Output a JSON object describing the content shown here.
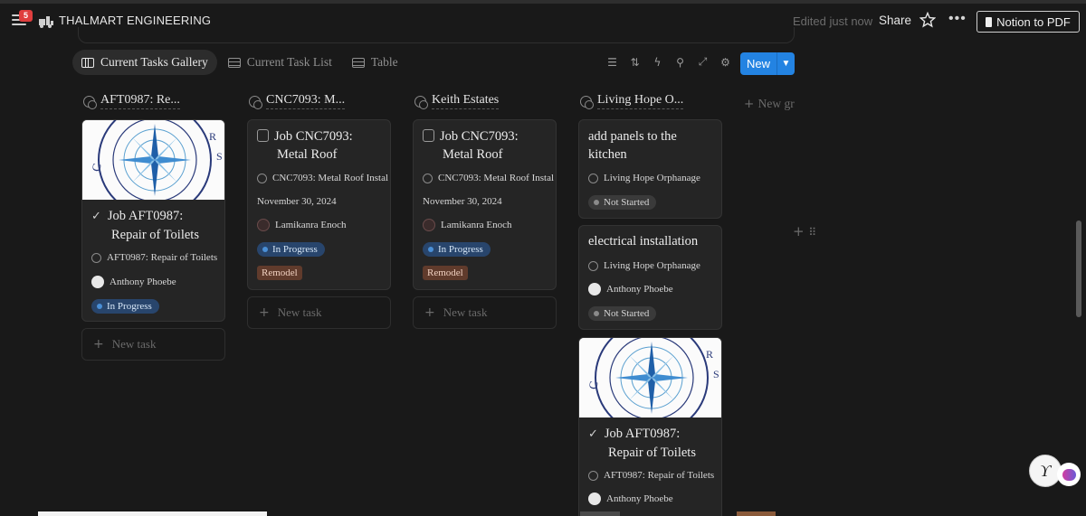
{
  "topbar": {
    "notification_count": "5",
    "workspace_title": "THALMART ENGINEERING",
    "edited_status": "Edited just now",
    "share_label": "Share",
    "notion_pdf_label": "Notion to PDF"
  },
  "views": {
    "tabs": [
      {
        "label": "Current Tasks Gallery",
        "active": true,
        "icon": "gallery-icon"
      },
      {
        "label": "Current Task List",
        "active": false,
        "icon": "table-icon"
      },
      {
        "label": "Table",
        "active": false,
        "icon": "table-icon"
      }
    ],
    "new_label": "New"
  },
  "toolbar_icons": [
    "filter-icon",
    "sort-icon",
    "automation-icon",
    "search-icon",
    "expand-icon",
    "settings-icon"
  ],
  "groups": [
    {
      "title": "AFT0987: Re..."
    },
    {
      "title": "CNC7093: M..."
    },
    {
      "title": "Keith Estates"
    },
    {
      "title": "Living Hope O..."
    }
  ],
  "new_group_label": "New gr",
  "new_task_label": "New task",
  "cards": {
    "aft_1": {
      "title_line1": "Job AFT0987:",
      "title_line2": "Repair of Toilets",
      "project": "AFT0987: Repair of Toilets",
      "assignee": "Anthony Phoebe",
      "status": "In Progress"
    },
    "cnc_1": {
      "title_line1": "Job CNC7093:",
      "title_line2": "Metal Roof",
      "project": "CNC7093: Metal Roof Instal",
      "date": "November 30, 2024",
      "assignee": "Lamikanra Enoch",
      "status": "In Progress",
      "tag": "Remodel"
    },
    "keith_1": {
      "title_line1": "Job CNC7093:",
      "title_line2": "Metal Roof",
      "project": "CNC7093: Metal Roof Instal",
      "date": "November 30, 2024",
      "assignee": "Lamikanra Enoch",
      "status": "In Progress",
      "tag": "Remodel"
    },
    "lh_1": {
      "title_line1": "add panels to the",
      "title_line2": "kitchen",
      "project": "Living Hope Orphanage",
      "status": "Not Started"
    },
    "lh_2": {
      "title": "electrical installation",
      "project": "Living Hope Orphanage",
      "assignee": "Anthony Phoebe",
      "status": "Not Started"
    },
    "lh_3": {
      "title_line1": "Job AFT0987:",
      "title_line2": "Repair of Toilets",
      "project": "AFT0987: Repair of Toilets",
      "assignee": "Anthony Phoebe"
    }
  },
  "colors": {
    "background": "#191919",
    "card": "#252525",
    "accent_blue": "#2383e2",
    "in_progress": "#28456c",
    "remodel": "#603b2c"
  }
}
